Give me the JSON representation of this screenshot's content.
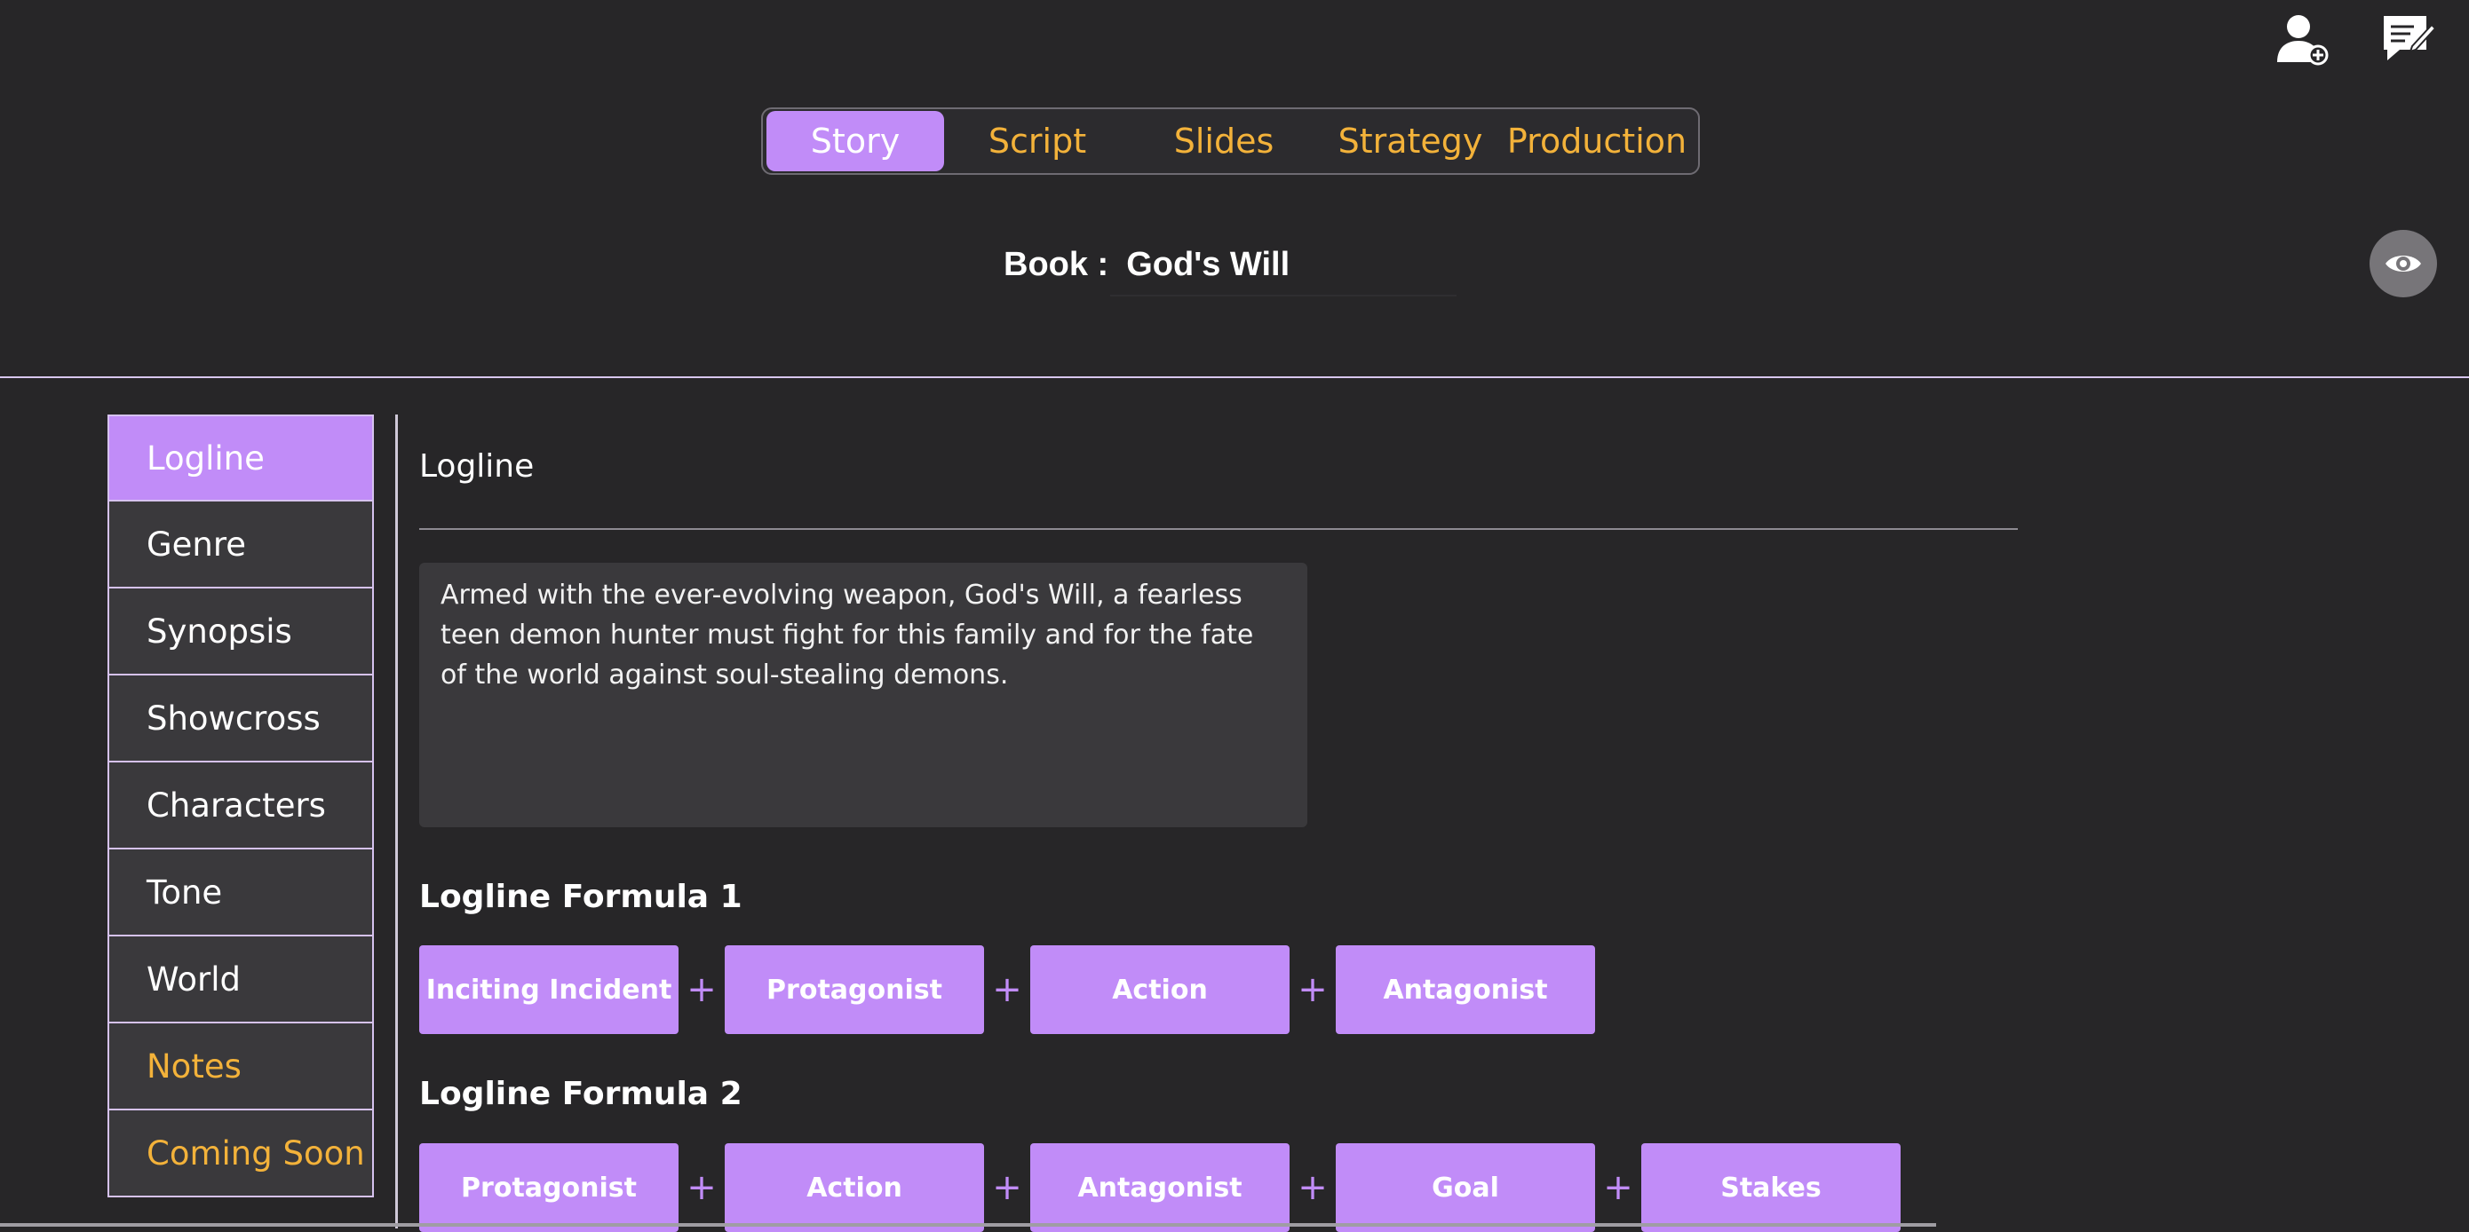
{
  "header": {
    "add_user_icon": "add-user-icon",
    "notes_icon": "edit-notes-icon"
  },
  "tabs": [
    {
      "label": "Story",
      "active": true
    },
    {
      "label": "Script",
      "active": false
    },
    {
      "label": "Slides",
      "active": false
    },
    {
      "label": "Strategy",
      "active": false
    },
    {
      "label": "Production",
      "active": false
    }
  ],
  "book": {
    "label": "Book :",
    "title": "God's Will"
  },
  "sidebar": {
    "items": [
      {
        "label": "Logline",
        "active": true
      },
      {
        "label": "Genre"
      },
      {
        "label": "Synopsis"
      },
      {
        "label": "Showcross"
      },
      {
        "label": "Characters"
      },
      {
        "label": "Tone"
      },
      {
        "label": "World"
      },
      {
        "label": "Notes",
        "highlight": true
      },
      {
        "label": "Coming Soon",
        "highlight": true
      }
    ]
  },
  "main": {
    "section_title": "Logline",
    "logline_text": "Armed with the ever-evolving weapon, God's Will, a fearless teen demon hunter must fight for this family and for the fate of the world against soul-stealing demons.",
    "formula1": {
      "title": "Logline Formula 1",
      "parts": [
        "Inciting Incident",
        "Protagonist",
        "Action",
        "Antagonist"
      ]
    },
    "formula2": {
      "title": "Logline Formula 2",
      "parts": [
        "Protagonist",
        "Action",
        "Antagonist",
        "Goal",
        "Stakes"
      ]
    },
    "plus_symbol": "+"
  },
  "colors": {
    "accent": "#c18cf8",
    "highlight": "#f3b23a",
    "background": "#272628"
  }
}
